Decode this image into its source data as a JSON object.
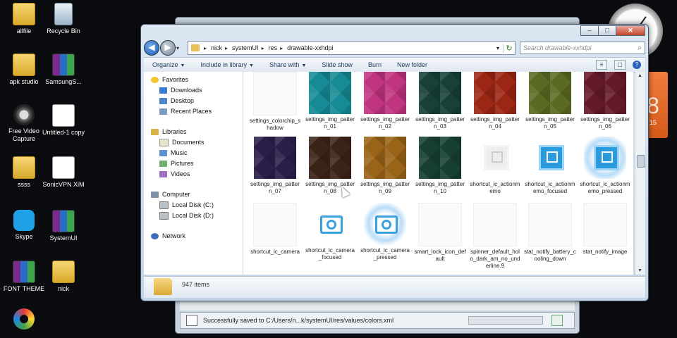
{
  "desktop_icons": [
    {
      "name": "allfile",
      "kind": "folder"
    },
    {
      "name": "Recycle Bin",
      "kind": "bin"
    },
    {
      "name": "apk studio",
      "kind": "folder"
    },
    {
      "name": "SamsungS...",
      "kind": "rar"
    },
    {
      "name": "Free Video Capture",
      "kind": "video"
    },
    {
      "name": "Untitled-1 copy",
      "kind": "doc"
    },
    {
      "name": "ssss",
      "kind": "folder"
    },
    {
      "name": "SonicVPN XiM",
      "kind": "vpn"
    },
    {
      "name": "Skype",
      "kind": "skype"
    },
    {
      "name": "SystemUI",
      "kind": "rar"
    },
    {
      "name": "FONT THEME",
      "kind": "rar"
    },
    {
      "name": "nick",
      "kind": "folder"
    },
    {
      "name": "",
      "kind": "ring"
    }
  ],
  "calendar": {
    "big": "8",
    "small": "15"
  },
  "back_window": {
    "status_message": "Successfully saved to C:/Users/n...k/systemUI/res/values/colors.xml"
  },
  "explorer": {
    "caption": {
      "minimize": "–",
      "maximize": "□",
      "close": "✕"
    },
    "breadcrumb": [
      "nick",
      "systemUI",
      "res",
      "drawable-xxhdpi"
    ],
    "search_placeholder": "Search drawable-xxhdpi",
    "toolbar": [
      "Organize",
      "Include in library",
      "Share with",
      "Slide show",
      "Burn",
      "New folder"
    ],
    "nav": {
      "favorites_label": "Favorites",
      "favorites": [
        "Downloads",
        "Desktop",
        "Recent Places"
      ],
      "libraries_label": "Libraries",
      "libraries": [
        "Documents",
        "Music",
        "Pictures",
        "Videos"
      ],
      "computer_label": "Computer",
      "drives": [
        "Local Disk (C:)",
        "Local Disk (D:)"
      ],
      "network_label": "Network"
    },
    "files": [
      {
        "name": "settings_colorchip_shadow",
        "style": "ghost"
      },
      {
        "name": "settings_img_pattern_01",
        "style": "pattern",
        "color": "#168b95"
      },
      {
        "name": "settings_img_pattern_02",
        "style": "pattern",
        "color": "#c03480"
      },
      {
        "name": "settings_img_pattern_03",
        "style": "pattern",
        "color": "#183f38"
      },
      {
        "name": "settings_img_pattern_04",
        "style": "pattern",
        "color": "#9c2614"
      },
      {
        "name": "settings_img_pattern_05",
        "style": "pattern",
        "color": "#5b6a22"
      },
      {
        "name": "settings_img_pattern_06",
        "style": "pattern",
        "color": "#651a2b"
      },
      {
        "name": "settings_img_pattern_07",
        "style": "pattern",
        "color": "#2b1e4a"
      },
      {
        "name": "settings_img_pattern_08",
        "style": "pattern",
        "color": "#3b2318"
      },
      {
        "name": "settings_img_pattern_09",
        "style": "pattern",
        "color": "#9a6418"
      },
      {
        "name": "settings_img_pattern_10",
        "style": "pattern",
        "color": "#173f33"
      },
      {
        "name": "shortcut_ic_actionmemo",
        "style": "memo-grey"
      },
      {
        "name": "shortcut_ic_actionmemo_focused",
        "style": "memo"
      },
      {
        "name": "shortcut_ic_actionmemo_pressed",
        "style": "memo-glow"
      },
      {
        "name": "shortcut_ic_camera",
        "style": "ghost"
      },
      {
        "name": "shortcut_ic_camera_focused",
        "style": "camera"
      },
      {
        "name": "shortcut_ic_camera_pressed",
        "style": "camera-glow"
      },
      {
        "name": "smart_lock_icon_default",
        "style": "ghost"
      },
      {
        "name": "spinner_default_holo_dark_am_no_underline.9",
        "style": "ghost"
      },
      {
        "name": "stat_notify_battery_cooling_down",
        "style": "ghost"
      },
      {
        "name": "stat_notify_image",
        "style": "ghost"
      }
    ],
    "item_count": "947 items"
  }
}
